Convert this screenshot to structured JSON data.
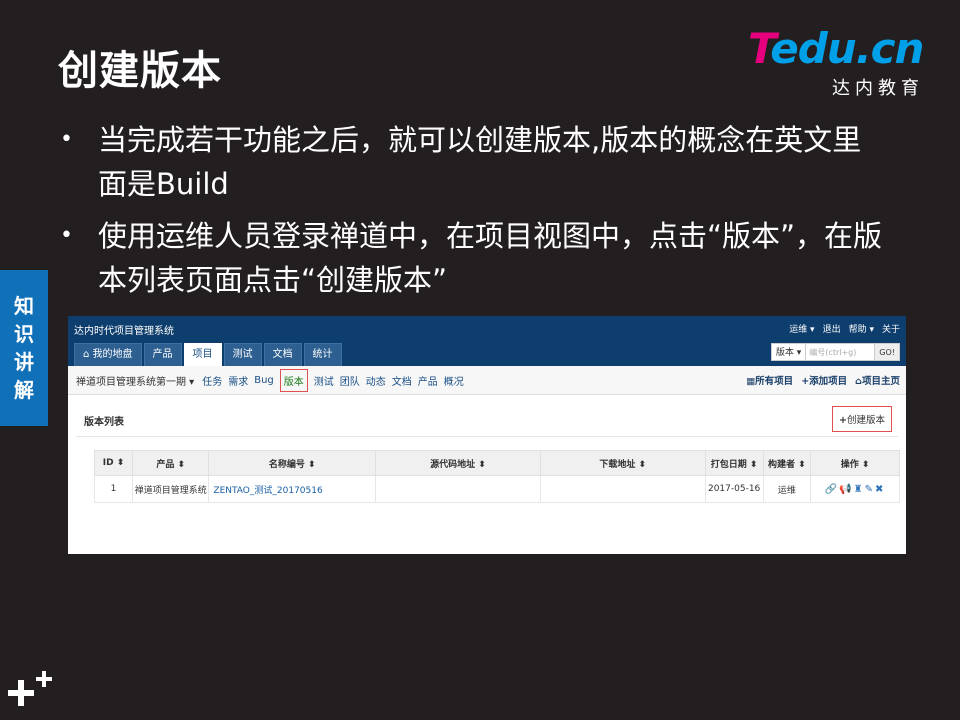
{
  "slide": {
    "title": "创建版本",
    "bullets": [
      "当完成若干功能之后，就可以创建版本,版本的概念在英文里面是Build",
      "使用运维人员登录禅道中，在项目视图中，点击“版本”，在版本列表页面点击“创建版本”"
    ],
    "side_tab": [
      "知",
      "识",
      "讲",
      "解"
    ]
  },
  "logo": {
    "main_t": "T",
    "main_rest": "edu.cn",
    "sub": "达内教育"
  },
  "app": {
    "system_name": "达内时代项目管理系统",
    "top_links": [
      "运维 ▾",
      "退出",
      "帮助 ▾",
      "关于"
    ],
    "tabs": [
      "我的地盘",
      "产品",
      "项目",
      "测试",
      "文档",
      "统计"
    ],
    "active_tab": "项目",
    "search": {
      "type": "版本 ▾",
      "placeholder": "编号(ctrl+g)",
      "button": "GO!"
    },
    "breadcrumb": "禅道项目管理系统第一期 ▾",
    "subnav": [
      "任务",
      "需求",
      "Bug",
      "版本",
      "测试",
      "团队",
      "动态",
      "文档",
      "产品",
      "概况"
    ],
    "subnav_active": "版本",
    "subnav_right": [
      "所有项目",
      "添加项目",
      "项目主页"
    ],
    "panel_title": "版本列表",
    "create_button": "创建版本",
    "table": {
      "headers": [
        "ID ⬍",
        "产品 ⬍",
        "名称编号 ⬍",
        "源代码地址 ⬍",
        "下载地址 ⬍",
        "打包日期 ⬍",
        "构建者 ⬍",
        "操作 ⬍"
      ],
      "rows": [
        [
          "1",
          "禅道项目管理系统",
          "ZENTAO_测试_20170516",
          "",
          "",
          "2017-05-16",
          "运维",
          "🔗📢♜✎✖"
        ]
      ]
    }
  },
  "colors": {
    "background": "#231f20",
    "accent_blue": "#1171b8",
    "app_header": "#0e3e6d"
  }
}
